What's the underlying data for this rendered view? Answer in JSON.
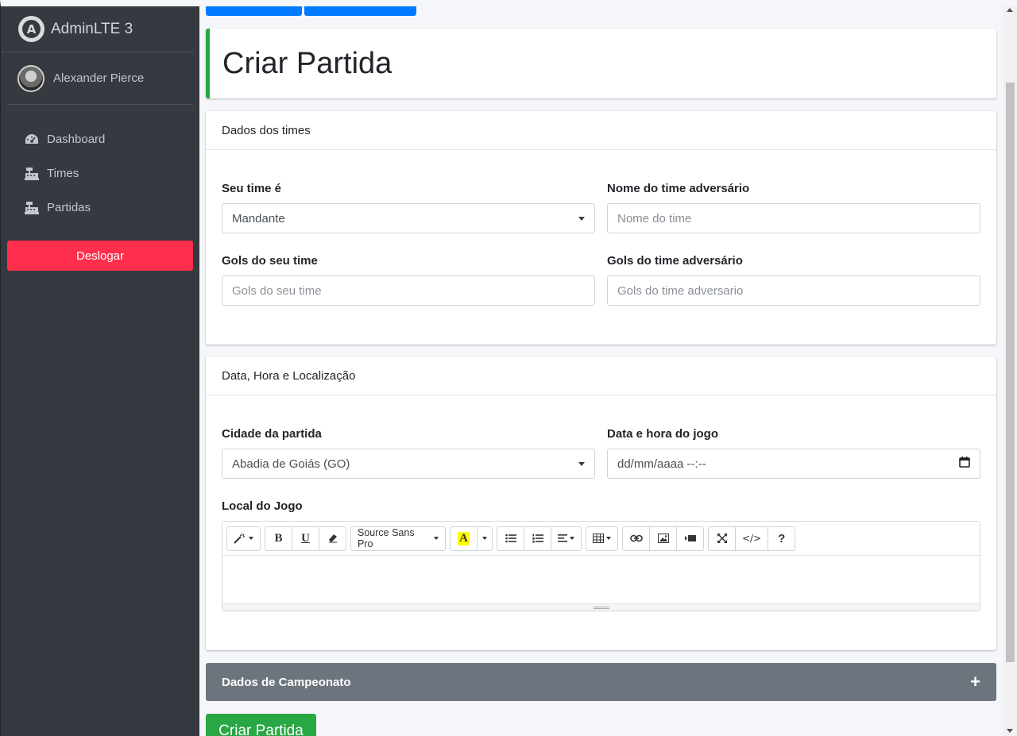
{
  "brand": {
    "title": "AdminLTE 3",
    "logo_letter": "A"
  },
  "user": {
    "name": "Alexander Pierce"
  },
  "nav": {
    "items": [
      {
        "label": "Dashboard",
        "icon": "tachometer-icon"
      },
      {
        "label": "Times",
        "icon": "cash-register-icon"
      },
      {
        "label": "Partidas",
        "icon": "cash-register-icon"
      }
    ],
    "logout_label": "Deslogar"
  },
  "page": {
    "title": "Criar Partida"
  },
  "teams_card": {
    "header": "Dados dos times",
    "your_team_label": "Seu time é",
    "your_team_value": "Mandante",
    "opponent_label": "Nome do time adversário",
    "opponent_placeholder": "Nome do time",
    "your_goals_label": "Gols do seu time",
    "your_goals_placeholder": "Gols do seu time",
    "opp_goals_label": "Gols do time adversário",
    "opp_goals_placeholder": "Gols do time adversario"
  },
  "location_card": {
    "header": "Data, Hora e Localização",
    "city_label": "Cidade da partida",
    "city_value": "Abadia de Goiás (GO)",
    "datetime_label": "Data e hora do jogo",
    "datetime_placeholder": "dd/mm/aaaa --:--",
    "venue_label": "Local do Jogo",
    "editor_font": "Source Sans Pro"
  },
  "championship_card": {
    "header": "Dados de Campeonato",
    "toggle": "+"
  },
  "submit_label": "Criar Partida",
  "colors": {
    "sidebar": "#343a40",
    "logout": "#ff2e4c",
    "success": "#28a745",
    "primary": "#007bff",
    "collapsed": "#6c757d"
  }
}
